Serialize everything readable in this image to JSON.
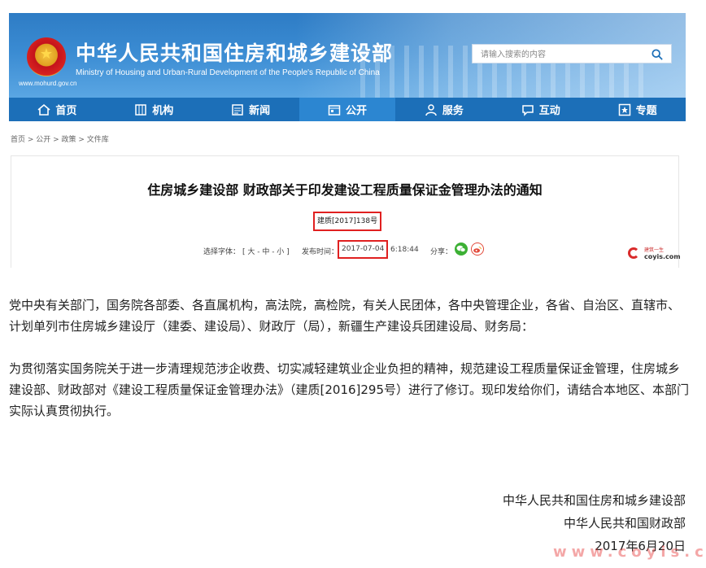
{
  "header": {
    "title_cn": "中华人民共和国住房和城乡建设部",
    "title_en": "Ministry of Housing and Urban-Rural Development of the People's Republic of China",
    "url": "www.mohurd.gov.cn",
    "search_placeholder": "请输入搜索的内容",
    "bg_color": "#2e7cc5"
  },
  "nav": {
    "items": [
      {
        "label": "首页",
        "icon": "home-icon"
      },
      {
        "label": "机构",
        "icon": "building-icon"
      },
      {
        "label": "新闻",
        "icon": "news-icon"
      },
      {
        "label": "公开",
        "icon": "open-icon"
      },
      {
        "label": "服务",
        "icon": "service-icon"
      },
      {
        "label": "互动",
        "icon": "chat-icon"
      },
      {
        "label": "专题",
        "icon": "star-icon"
      }
    ],
    "active_index": 3,
    "bar_color": "#1c6fb8"
  },
  "breadcrumb": "首页 > 公开 > 政策 > 文件库",
  "article": {
    "title": "住房城乡建设部 财政部关于印发建设工程质量保证金管理办法的通知",
    "doc_number": "建质[2017]138号",
    "font_label": "选择字体：",
    "font_sizes": "[ 大 - 中 - 小 ]",
    "date_label": "发布时间：",
    "date": "2017-07-04",
    "time": "6:18:44",
    "share_label": "分享：",
    "highlight_color": "#e02020"
  },
  "watermark": {
    "line1": "建筑一生",
    "line2": "coyis.com"
  },
  "content": {
    "addressees": "党中央有关部门，国务院各部委、各直属机构，高法院，高检院，有关人民团体，各中央管理企业，各省、自治区、直辖市、计划单列市住房城乡建设厅（建委、建设局）、财政厅（局），新疆生产建设兵团建设局、财务局：",
    "paragraph1": "为贯彻落实国务院关于进一步清理规范涉企收费、切实减轻建筑业企业负担的精神，规范建设工程质量保证金管理，住房城乡建设部、财政部对《建设工程质量保证金管理办法》（建质[2016]295号）进行了修订。现印发给你们，请结合本地区、本部门实际认真贯彻执行。",
    "signature1": "中华人民共和国住房和城乡建设部",
    "signature2": "中华人民共和国财政部",
    "signature_date": "2017年6月20日"
  },
  "overlay_watermark": "www.coyis.c"
}
